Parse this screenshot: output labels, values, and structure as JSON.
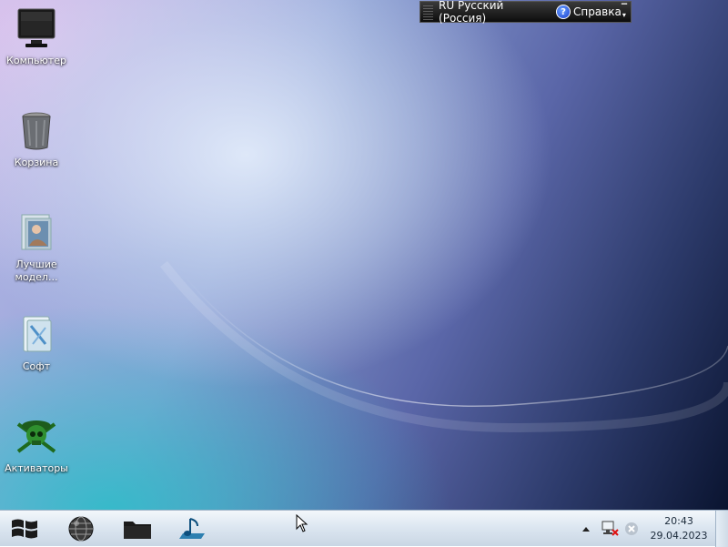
{
  "desktop": {
    "icons": [
      {
        "label": "Компьютер",
        "icon": "computer-icon"
      },
      {
        "label": "Корзина",
        "icon": "recycle-bin-icon"
      },
      {
        "label": "Лучшие модел...",
        "icon": "image-folder-icon"
      },
      {
        "label": "Софт",
        "icon": "software-folder-icon"
      },
      {
        "label": "Активаторы",
        "icon": "pirate-skull-icon"
      }
    ]
  },
  "language_bar": {
    "language": "RU Русский (Россия)",
    "help_label": "Справка",
    "help_icon": "help-icon",
    "menu_icon": "options-arrow-icon"
  },
  "taskbar": {
    "buttons": [
      {
        "name": "start",
        "icon": "windows-logo-icon"
      },
      {
        "name": "browser",
        "icon": "globe-icon"
      },
      {
        "name": "explorer",
        "icon": "folder-icon"
      },
      {
        "name": "media",
        "icon": "music-note-icon"
      }
    ],
    "tray": {
      "icons": [
        "show-hidden-icons-arrow",
        "network-disconnected-icon",
        "close-circle-icon"
      ]
    },
    "clock": {
      "time": "20:43",
      "date": "29.04.2023"
    }
  },
  "colors": {
    "taskbar_text": "#1b2a3a",
    "langbar_bg": "#111111"
  }
}
